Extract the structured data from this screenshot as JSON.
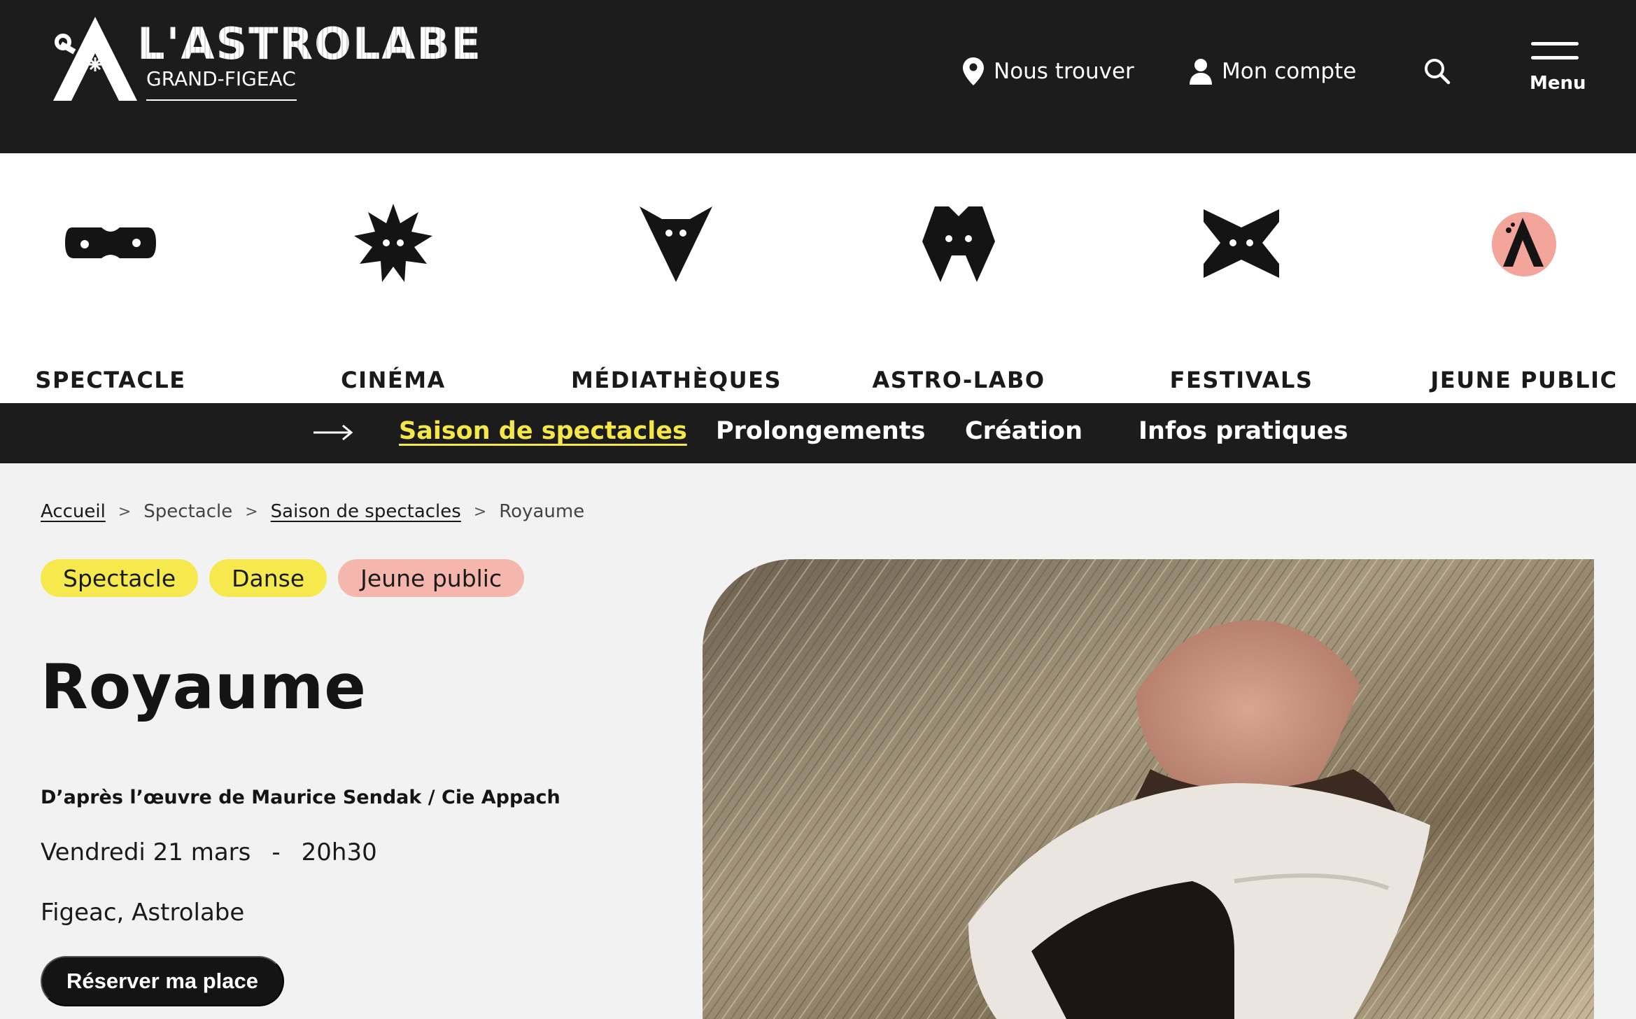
{
  "header": {
    "logo_title": "L'ASTROLABE",
    "logo_subtitle": "GRAND-FIGEAC",
    "find_us_label": "Nous trouver",
    "account_label": "Mon compte",
    "menu_label": "Menu",
    "icons": [
      "location-pin-icon",
      "user-icon",
      "search-icon",
      "hamburger-menu-icon"
    ]
  },
  "categories": [
    {
      "label": "SPECTACLE",
      "icon": "spectacle-mask-icon"
    },
    {
      "label": "CINÉMA",
      "icon": "cinema-star-icon"
    },
    {
      "label": "MÉDIATHÈQUES",
      "icon": "mediatheques-fox-icon"
    },
    {
      "label": "ASTRO-LABO",
      "icon": "astro-labo-creature-icon"
    },
    {
      "label": "FESTIVALS",
      "icon": "festivals-bowtie-icon"
    },
    {
      "label": "JEUNE PUBLIC",
      "icon": "jeune-public-a-icon"
    }
  ],
  "subnav": {
    "items": [
      "Saison de spectacles",
      "Prolongements",
      "Création",
      "Infos pratiques"
    ],
    "active": "Saison de spectacles"
  },
  "breadcrumb": {
    "home": "Accueil",
    "separator": ">",
    "level1": "Spectacle",
    "level2": "Saison de spectacles",
    "current": "Royaume"
  },
  "tags": [
    "Spectacle",
    "Danse",
    "Jeune public"
  ],
  "event": {
    "title": "Royaume",
    "subtitle": "D’après l’œuvre de Maurice Sendak / Cie Appach",
    "date": "Vendredi 21 mars",
    "date_separator": "-",
    "time": "20h30",
    "place": "Figeac, Astrolabe",
    "cta_label": "Réserver ma place"
  },
  "colors": {
    "header_bg": "#1c1c1c",
    "accent_yellow": "#f6e94d",
    "accent_pink": "#f5b6ad",
    "active_link": "#f5e74a"
  }
}
